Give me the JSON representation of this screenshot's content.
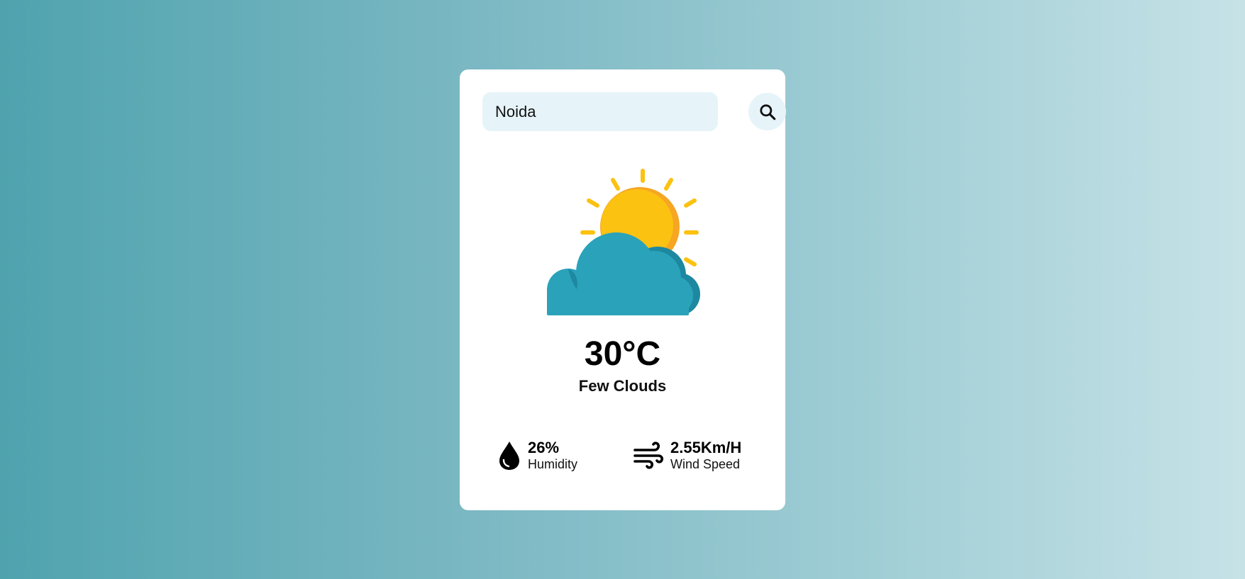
{
  "search": {
    "value": "Noida",
    "placeholder": ""
  },
  "weather": {
    "icon": "sun-behind-cloud-icon",
    "temperature": "30°C",
    "condition": "Few Clouds"
  },
  "details": {
    "humidity": {
      "icon": "water-drop-icon",
      "value": "26%",
      "label": "Humidity"
    },
    "wind": {
      "icon": "wind-icon",
      "value": "2.55Km/H",
      "label": "Wind Speed"
    }
  },
  "colors": {
    "sun": "#fcc212",
    "sun_shade": "#f6a623",
    "cloud": "#2aa2ba",
    "cloud_shade": "#1d88a0",
    "input_bg": "#e6f4fa"
  }
}
